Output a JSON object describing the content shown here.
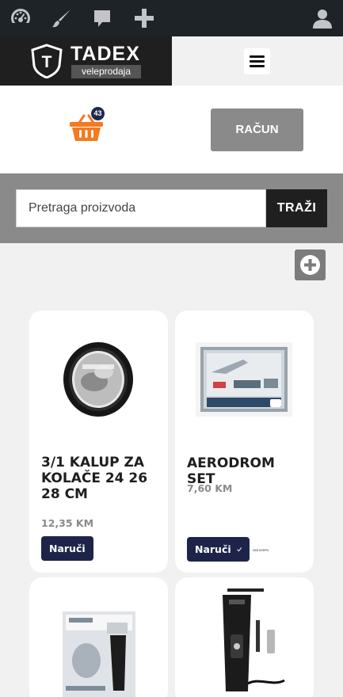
{
  "adminbar": {
    "icons": [
      "dashboard-icon",
      "customize-brush-icon",
      "comments-icon",
      "new-plus-icon",
      "user-account-icon"
    ]
  },
  "header": {
    "logo_initial": "T",
    "logo_name": "TADEX",
    "logo_subtitle": "veleprodaja",
    "menu_icon": "hamburger-menu-icon"
  },
  "cart": {
    "icon": "shopping-basket-icon",
    "count": "43",
    "account_label": "RAČUN"
  },
  "search": {
    "placeholder": "Pretraga proizvoda",
    "button_label": "TRAŽI"
  },
  "add_icon": "plus-circle-icon",
  "products": [
    {
      "title_lines": [
        "3/1 KALUP ZA",
        "KOLAČE 24 26",
        "28 CM"
      ],
      "price": "12,35 KM",
      "order_label": "Naruči",
      "image": "round cake tin set"
    },
    {
      "title_lines": [
        "AERODROM SET"
      ],
      "price": "7,60 KM",
      "order_label": "Naruči",
      "order_state_icon": "checkmark-icon",
      "note": "VIDI KORPU",
      "image": "airport toy set box"
    },
    {
      "title_lines": [],
      "image": "Norelco hair clipper box"
    },
    {
      "title_lines": [],
      "image": "Rozia trimmer with accessories"
    }
  ],
  "colors": {
    "adminbar_bg": "#1d2327",
    "header_bg": "#1f1f1f",
    "cart_orange": "#f47a20",
    "order_button_bg": "#1e2449",
    "price_gray": "#8a8a8a",
    "search_band_bg": "#8a8a8a"
  }
}
